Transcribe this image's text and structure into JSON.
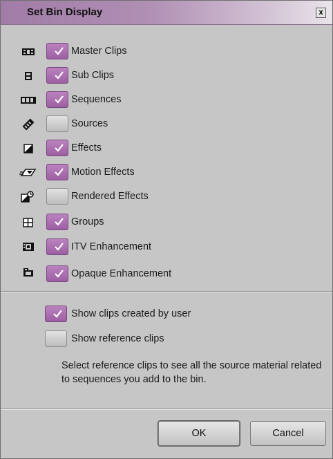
{
  "dialog": {
    "title": "Set Bin Display",
    "close_label": "x"
  },
  "items": [
    {
      "label": "Master Clips",
      "checked": true,
      "icon": "master-clip-icon"
    },
    {
      "label": "Sub Clips",
      "checked": true,
      "icon": "subclip-icon"
    },
    {
      "label": "Sequences",
      "checked": true,
      "icon": "sequence-icon"
    },
    {
      "label": "Sources",
      "checked": false,
      "icon": "source-icon"
    },
    {
      "label": "Effects",
      "checked": true,
      "icon": "effect-icon"
    },
    {
      "label": "Motion Effects",
      "checked": true,
      "icon": "motion-effect-icon"
    },
    {
      "label": "Rendered Effects",
      "checked": false,
      "icon": "rendered-effect-icon"
    },
    {
      "label": "Groups",
      "checked": true,
      "icon": "group-icon"
    },
    {
      "label": "ITV Enhancement",
      "checked": true,
      "icon": "itv-enhancement-icon"
    },
    {
      "label": "Opaque Enhancement",
      "checked": true,
      "icon": "opaque-enhancement-icon"
    }
  ],
  "options": [
    {
      "label": "Show clips created by user",
      "checked": true
    },
    {
      "label": "Show reference clips",
      "checked": false
    }
  ],
  "description": "Select reference clips to see all the source material related to sequences you add to the bin.",
  "buttons": {
    "ok": "OK",
    "cancel": "Cancel"
  },
  "colors": {
    "checked": "#a86cae",
    "title_bar": "#a07ca6",
    "background": "#c6c6c6"
  }
}
